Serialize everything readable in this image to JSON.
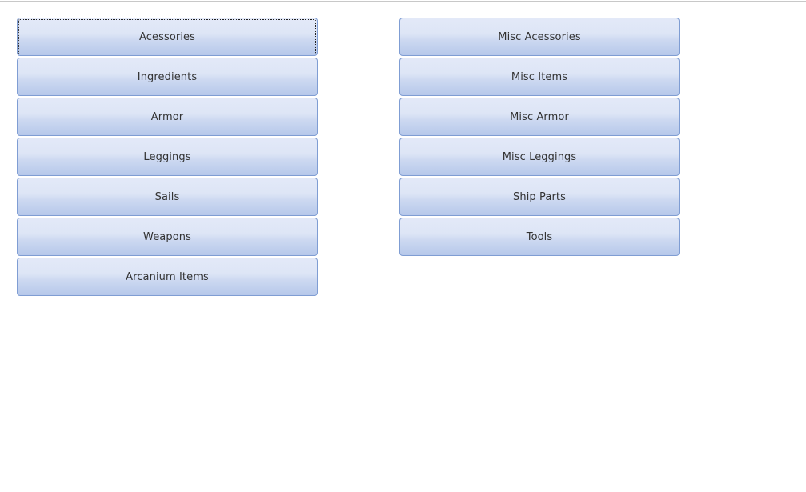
{
  "theme": {
    "page_background": "#ffffff",
    "button_border": "#7f9dd3",
    "button_gradient_top": "#e3e9f8",
    "button_gradient_bottom": "#b6c8ea",
    "button_text": "#333333",
    "top_rule": "#c8c8c8",
    "focus_outline": "#202020"
  },
  "panel": {
    "columns": [
      {
        "name": "left-category-column",
        "buttons": [
          {
            "label": "Acessories",
            "focused": true
          },
          {
            "label": "Ingredients",
            "focused": false
          },
          {
            "label": "Armor",
            "focused": false
          },
          {
            "label": "Leggings",
            "focused": false
          },
          {
            "label": "Sails",
            "focused": false
          },
          {
            "label": "Weapons",
            "focused": false
          },
          {
            "label": "Arcanium Items",
            "focused": false
          }
        ]
      },
      {
        "name": "right-category-column",
        "buttons": [
          {
            "label": "Misc Acessories",
            "focused": false
          },
          {
            "label": "Misc Items",
            "focused": false
          },
          {
            "label": "Misc Armor",
            "focused": false
          },
          {
            "label": "Misc Leggings",
            "focused": false
          },
          {
            "label": "Ship Parts",
            "focused": false
          },
          {
            "label": "Tools",
            "focused": false
          }
        ]
      }
    ]
  }
}
